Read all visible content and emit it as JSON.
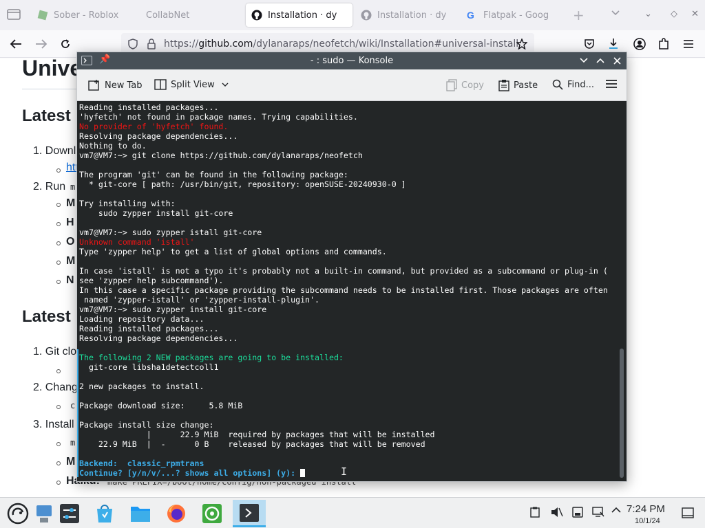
{
  "browser": {
    "tabs": [
      {
        "label": "Sober - Roblox",
        "active": false
      },
      {
        "label": "CollabNet",
        "active": false
      },
      {
        "label": "Installation · dy",
        "active": true
      },
      {
        "label": "Installation · dy",
        "active": false
      },
      {
        "label": "Flatpak - Goog",
        "active": false
      }
    ],
    "url_prefix": "https://",
    "url_host": "github.com",
    "url_path": "/dylanaraps/neofetch/wiki/Installation#universal-install"
  },
  "webpage": {
    "heading_univ": "Unive",
    "heading_latest1": "Latest",
    "heading_latest2": "Latest",
    "item1": "1. Downl",
    "item1_link": "htt",
    "item2": "2. Run",
    "item2_code": "m",
    "sub_m1": "M",
    "sub_h1": "H",
    "sub_o": "O",
    "sub_m2": "M",
    "sub_n": "N",
    "item_git": "1. Git clo",
    "item_change": "2. Chang",
    "item_change_sub": "c",
    "item_install": "3. Install",
    "install_sub1": "m",
    "install_sub2": "M",
    "haiku_label": "Haiku:",
    "haiku_code": "make PREFIX=/boot/home/config/non-packaged install"
  },
  "konsole": {
    "title": "- : sudo — Konsole",
    "toolbar": {
      "new_tab": "New Tab",
      "split_view": "Split View",
      "copy": "Copy",
      "paste": "Paste",
      "find": "Find..."
    },
    "lines": [
      {
        "t": "Reading installed packages...",
        "c": ""
      },
      {
        "t": "'hyfetch' not found in package names. Trying capabilities.",
        "c": ""
      },
      {
        "t": "No provider of 'hyfetch' found.",
        "c": "red"
      },
      {
        "t": "Resolving package dependencies...",
        "c": ""
      },
      {
        "t": "Nothing to do.",
        "c": ""
      },
      {
        "t": "vm7@VM7:~> git clone https://github.com/dylanaraps/neofetch",
        "c": ""
      },
      {
        "t": "",
        "c": ""
      },
      {
        "t": "The program 'git' can be found in the following package:",
        "c": ""
      },
      {
        "t": "  * git-core [ path: /usr/bin/git, repository: openSUSE-20240930-0 ]",
        "c": ""
      },
      {
        "t": "",
        "c": ""
      },
      {
        "t": "Try installing with:",
        "c": ""
      },
      {
        "t": "    sudo zypper install git-core",
        "c": ""
      },
      {
        "t": "",
        "c": ""
      },
      {
        "t": "vm7@VM7:~> sudo zypper istall git-core",
        "c": ""
      },
      {
        "t": "Unknown command 'istall'",
        "c": "red"
      },
      {
        "t": "Type 'zypper help' to get a list of global options and commands.",
        "c": ""
      },
      {
        "t": "",
        "c": ""
      },
      {
        "t": "In case 'istall' is not a typo it's probably not a built-in command, but provided as a subcommand or plug-in (",
        "c": ""
      },
      {
        "t": "see 'zypper help subcommand').",
        "c": ""
      },
      {
        "t": "In this case a specific package providing the subcommand needs to be installed first. Those packages are often",
        "c": ""
      },
      {
        "t": " named 'zypper-istall' or 'zypper-install-plugin'.",
        "c": ""
      },
      {
        "t": "vm7@VM7:~> sudo zypper install git-core",
        "c": ""
      },
      {
        "t": "Loading repository data...",
        "c": ""
      },
      {
        "t": "Reading installed packages...",
        "c": ""
      },
      {
        "t": "Resolving package dependencies...",
        "c": ""
      },
      {
        "t": "",
        "c": ""
      },
      {
        "t": "The following 2 NEW packages are going to be installed:",
        "c": "green"
      },
      {
        "t": "  git-core libsha1detectcoll1",
        "c": ""
      },
      {
        "t": "",
        "c": ""
      },
      {
        "t": "2 new packages to install.",
        "c": ""
      },
      {
        "t": "",
        "c": ""
      },
      {
        "t": "Package download size:     5.8 MiB",
        "c": ""
      },
      {
        "t": "",
        "c": ""
      },
      {
        "t": "Package install size change:",
        "c": ""
      },
      {
        "t": "              |      22.9 MiB  required by packages that will be installed",
        "c": ""
      },
      {
        "t": "    22.9 MiB  |  -      0 B    released by packages that will be removed",
        "c": ""
      },
      {
        "t": "",
        "c": ""
      },
      {
        "t": "Backend:  classic_rpmtrans",
        "c": "blue"
      },
      {
        "t": "Continue? [y/n/v/...? shows all options] (y): ",
        "c": "blue"
      }
    ]
  },
  "taskbar": {
    "time": "7:24 PM",
    "date": "10/1/24",
    "apps": [
      "application-launcher-icon",
      "show-desktop-icon",
      "system-settings-icon",
      "discover-icon",
      "dolphin-icon",
      "firefox-icon",
      "sober-icon",
      "konsole-icon"
    ]
  },
  "colors": {
    "konsole_bg": "#232627",
    "konsole_title": "#475057",
    "error_red": "#ed1515",
    "success_green": "#1cdc9a",
    "prompt_blue": "#3daee9"
  }
}
